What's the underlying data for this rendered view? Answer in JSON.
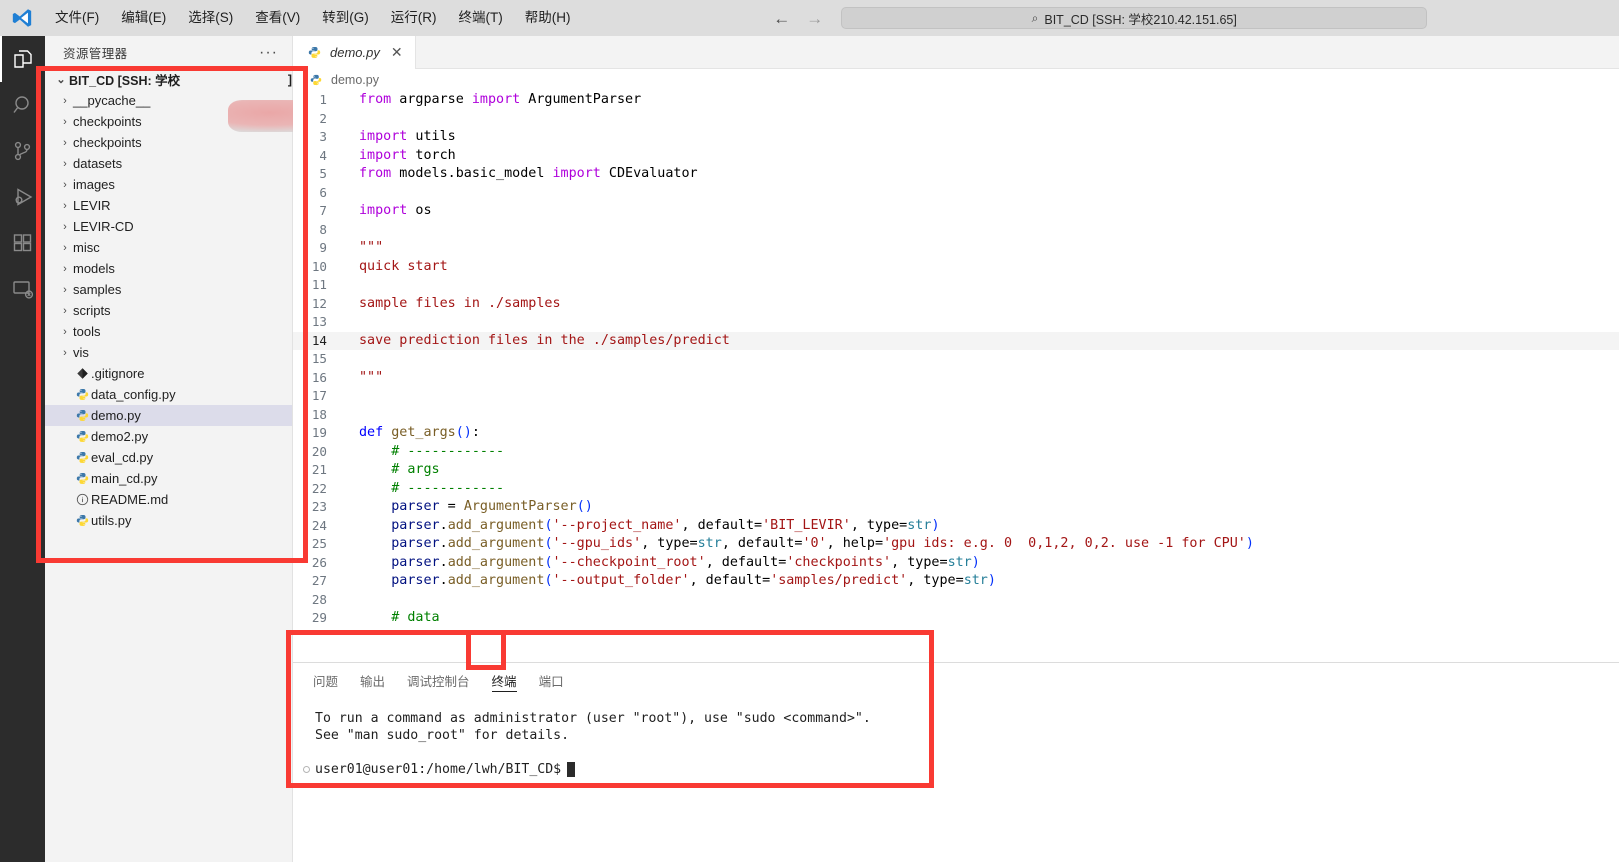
{
  "titlebar": {
    "logo_name": "vscode-logo",
    "menu": [
      {
        "label": "文件(F)",
        "name": "menu-file"
      },
      {
        "label": "编辑(E)",
        "name": "menu-edit"
      },
      {
        "label": "选择(S)",
        "name": "menu-selection"
      },
      {
        "label": "查看(V)",
        "name": "menu-view"
      },
      {
        "label": "转到(G)",
        "name": "menu-go"
      },
      {
        "label": "运行(R)",
        "name": "menu-run"
      },
      {
        "label": "终端(T)",
        "name": "menu-terminal"
      },
      {
        "label": "帮助(H)",
        "name": "menu-help"
      }
    ],
    "back_arrow": "←",
    "forward_arrow": "→",
    "search_icon": "⌕",
    "command_center_text": "BIT_CD [SSH: 学校210.42.151.65]"
  },
  "activitybar": {
    "items": [
      {
        "name": "explorer-icon",
        "label": "资源管理器",
        "active": true
      },
      {
        "name": "search-icon",
        "label": "搜索",
        "active": false
      },
      {
        "name": "source-control-icon",
        "label": "源代码管理",
        "active": false
      },
      {
        "name": "run-debug-icon",
        "label": "运行和调试",
        "active": false
      },
      {
        "name": "extensions-icon",
        "label": "扩展",
        "active": false
      },
      {
        "name": "remote-explorer-icon",
        "label": "远程资源管理器",
        "active": false
      }
    ]
  },
  "sidebar": {
    "title": "资源管理器",
    "more_actions": "···",
    "root": {
      "label": "BIT_CD [SSH: 学校",
      "label_tail": "]",
      "expanded": true,
      "chevron": "⌄"
    },
    "folders": [
      {
        "label": "__pycache__",
        "chevron": "›"
      },
      {
        "label": "checkpoints",
        "chevron": "›"
      },
      {
        "label": "checkpoints",
        "chevron": "›"
      },
      {
        "label": "datasets",
        "chevron": "›"
      },
      {
        "label": "images",
        "chevron": "›"
      },
      {
        "label": "LEVIR",
        "chevron": "›"
      },
      {
        "label": "LEVIR-CD",
        "chevron": "›"
      },
      {
        "label": "misc",
        "chevron": "›"
      },
      {
        "label": "models",
        "chevron": "›"
      },
      {
        "label": "samples",
        "chevron": "›"
      },
      {
        "label": "scripts",
        "chevron": "›"
      },
      {
        "label": "tools",
        "chevron": "›"
      },
      {
        "label": "vis",
        "chevron": "›"
      }
    ],
    "files": [
      {
        "label": ".gitignore",
        "icon": "git-file-icon",
        "selected": false
      },
      {
        "label": "data_config.py",
        "icon": "python-file-icon",
        "selected": false
      },
      {
        "label": "demo.py",
        "icon": "python-file-icon",
        "selected": true
      },
      {
        "label": "demo2.py",
        "icon": "python-file-icon",
        "selected": false
      },
      {
        "label": "eval_cd.py",
        "icon": "python-file-icon",
        "selected": false
      },
      {
        "label": "main_cd.py",
        "icon": "python-file-icon",
        "selected": false
      },
      {
        "label": "README.md",
        "icon": "markdown-info-icon",
        "selected": false
      },
      {
        "label": "utils.py",
        "icon": "python-file-icon",
        "selected": false
      }
    ]
  },
  "editor": {
    "tab": {
      "label": "demo.py",
      "icon": "python-file-icon",
      "close": "✕",
      "dirty": false
    },
    "breadcrumb": {
      "icon": "python-file-icon",
      "label": "demo.py"
    },
    "current_line": 14,
    "lines": [
      {
        "n": 1,
        "text": "from argparse import ArgumentParser"
      },
      {
        "n": 2,
        "text": ""
      },
      {
        "n": 3,
        "text": "import utils"
      },
      {
        "n": 4,
        "text": "import torch"
      },
      {
        "n": 5,
        "text": "from models.basic_model import CDEvaluator"
      },
      {
        "n": 6,
        "text": ""
      },
      {
        "n": 7,
        "text": "import os"
      },
      {
        "n": 8,
        "text": ""
      },
      {
        "n": 9,
        "text": "\"\"\""
      },
      {
        "n": 10,
        "text": "quick start"
      },
      {
        "n": 11,
        "text": ""
      },
      {
        "n": 12,
        "text": "sample files in ./samples"
      },
      {
        "n": 13,
        "text": ""
      },
      {
        "n": 14,
        "text": "save prediction files in the ./samples/predict"
      },
      {
        "n": 15,
        "text": ""
      },
      {
        "n": 16,
        "text": "\"\"\""
      },
      {
        "n": 17,
        "text": ""
      },
      {
        "n": 18,
        "text": ""
      },
      {
        "n": 19,
        "text": "def get_args():"
      },
      {
        "n": 20,
        "text": "    # ------------"
      },
      {
        "n": 21,
        "text": "    # args"
      },
      {
        "n": 22,
        "text": "    # ------------"
      },
      {
        "n": 23,
        "text": "    parser = ArgumentParser()"
      },
      {
        "n": 24,
        "text": "    parser.add_argument('--project_name', default='BIT_LEVIR', type=str)"
      },
      {
        "n": 25,
        "text": "    parser.add_argument('--gpu_ids', type=str, default='0', help='gpu ids: e.g. 0  0,1,2, 0,2. use -1 for CPU')"
      },
      {
        "n": 26,
        "text": "    parser.add_argument('--checkpoint_root', default='checkpoints', type=str)"
      },
      {
        "n": 27,
        "text": "    parser.add_argument('--output_folder', default='samples/predict', type=str)"
      },
      {
        "n": 28,
        "text": ""
      },
      {
        "n": 29,
        "text": "    # data"
      }
    ]
  },
  "panel": {
    "tabs": [
      {
        "label": "问题",
        "name": "panel-tab-problems",
        "active": false
      },
      {
        "label": "输出",
        "name": "panel-tab-output",
        "active": false
      },
      {
        "label": "调试控制台",
        "name": "panel-tab-debug-console",
        "active": false
      },
      {
        "label": "终端",
        "name": "panel-tab-terminal",
        "active": true
      },
      {
        "label": "端口",
        "name": "panel-tab-ports",
        "active": false
      }
    ],
    "terminal": {
      "lines": [
        "To run a command as administrator (user \"root\"), use \"sudo <command>\".",
        "See \"man sudo_root\" for details."
      ],
      "prompt": "user01@user01:/home/lwh/BIT_CD$"
    }
  },
  "annotations": {
    "color": "#f93a33",
    "boxes": [
      {
        "name": "annotation-box-explorer"
      },
      {
        "name": "annotation-box-terminal-panel"
      },
      {
        "name": "annotation-box-terminal-tab"
      }
    ]
  }
}
